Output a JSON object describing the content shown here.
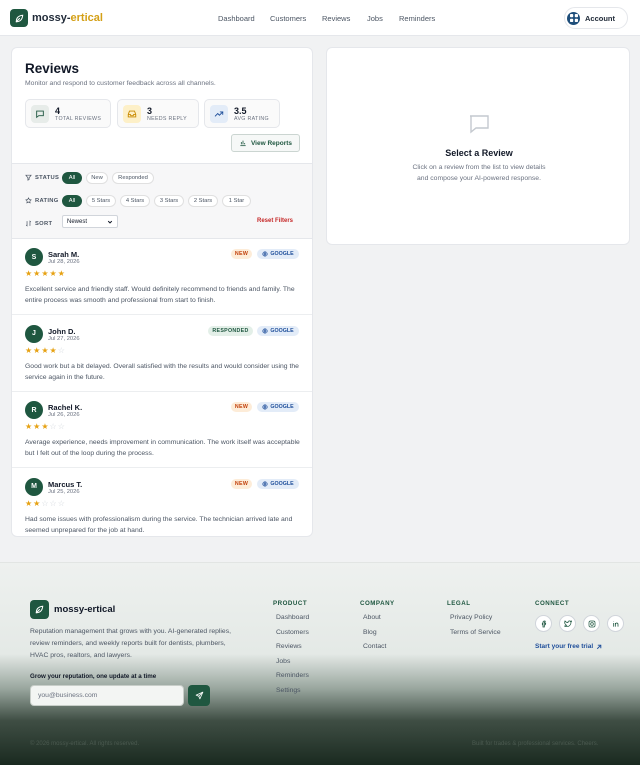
{
  "brand": {
    "name_main": "mossy-",
    "name_accent": "ertical",
    "footer_name": "mossy-ertical"
  },
  "nav": {
    "items": [
      "Dashboard",
      "Customers",
      "Reviews",
      "Jobs",
      "Reminders"
    ]
  },
  "account": {
    "label": "Account"
  },
  "reviews_page": {
    "title": "Reviews",
    "subtitle": "Monitor and respond to customer feedback across all channels.",
    "stats": [
      {
        "value": "4",
        "label": "TOTAL REVIEWS",
        "icon": "message-icon"
      },
      {
        "value": "3",
        "label": "NEEDS REPLY",
        "icon": "inbox-icon"
      },
      {
        "value": "3.5",
        "label": "AVG RATING",
        "icon": "trend-up-icon"
      }
    ],
    "view_reports": "View Reports"
  },
  "filters": {
    "status_label": "STATUS",
    "status_options": [
      "All",
      "New",
      "Responded"
    ],
    "rating_label": "RATING",
    "rating_options": [
      "All",
      "5 Stars",
      "4 Stars",
      "3 Stars",
      "2 Stars",
      "1 Star"
    ],
    "sort_label": "SORT",
    "sort_value": "Newest",
    "reset": "Reset Filters"
  },
  "reviews": [
    {
      "initial": "S",
      "name": "Sarah M.",
      "date": "Jul 28, 2026",
      "status": "NEW",
      "source": "GOOGLE",
      "rating": 5,
      "text": "Excellent service and friendly staff. Would definitely recommend to friends and family. The entire process was smooth and professional from start to finish."
    },
    {
      "initial": "J",
      "name": "John D.",
      "date": "Jul 27, 2026",
      "status": "RESPONDED",
      "source": "GOOGLE",
      "rating": 4,
      "text": "Good work but a bit delayed. Overall satisfied with the results and would consider using the service again in the future."
    },
    {
      "initial": "R",
      "name": "Rachel K.",
      "date": "Jul 26, 2026",
      "status": "NEW",
      "source": "GOOGLE",
      "rating": 3,
      "text": "Average experience, needs improvement in communication. The work itself was acceptable but I felt out of the loop during the process."
    },
    {
      "initial": "M",
      "name": "Marcus T.",
      "date": "Jul 25, 2026",
      "status": "NEW",
      "source": "GOOGLE",
      "rating": 2,
      "text": "Had some issues with professionalism during the service. The technician arrived late and seemed unprepared for the job at hand."
    }
  ],
  "detail": {
    "title": "Select a Review",
    "text": "Click on a review from the list to view details and compose your AI-powered response."
  },
  "footer": {
    "description": "Reputation management that grows with you. AI-generated replies, review reminders, and weekly reports built for dentists, plumbers, HVAC pros, realtors, and lawyers.",
    "newsletter_label": "Grow your reputation, one update at a time",
    "newsletter_placeholder": "you@business.com",
    "product": {
      "title": "PRODUCT",
      "links": [
        "Dashboard",
        "Customers",
        "Reviews",
        "Jobs",
        "Reminders",
        "Settings"
      ]
    },
    "company": {
      "title": "COMPANY",
      "links": [
        "About",
        "Blog",
        "Contact"
      ]
    },
    "legal": {
      "title": "LEGAL",
      "links": [
        "Privacy Policy",
        "Terms of Service"
      ]
    },
    "connect": {
      "title": "CONNECT",
      "trial": "Start your free trial"
    },
    "copyright": "© 2026 mossy-ertical. All rights reserved.",
    "built_for": "Built for trades & professional services. Cheers."
  },
  "colors": {
    "brand": "#1f5740",
    "accent": "#d4a017",
    "star": "#e6a112",
    "new": "#c2410c",
    "google": "#1e4e9a",
    "reset": "#c62828"
  }
}
